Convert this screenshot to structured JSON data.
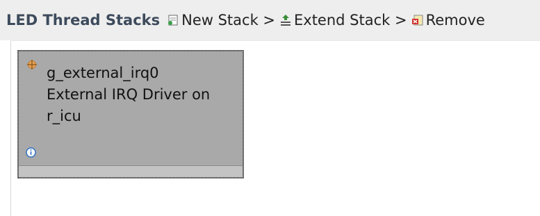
{
  "toolbar": {
    "title": "LED Thread Stacks",
    "new_stack": "New Stack >",
    "extend_stack": "Extend Stack >",
    "remove": "Remove"
  },
  "module": {
    "name": "g_external_irq0",
    "line2": "External IRQ Driver on",
    "line3": "r_icu",
    "icon": "crosshair-icon",
    "info_icon": "info-icon"
  },
  "colors": {
    "toolbar_bg": "#eeeeee",
    "module_bg": "#a9a9a9",
    "title_color": "#3d4b5c"
  }
}
